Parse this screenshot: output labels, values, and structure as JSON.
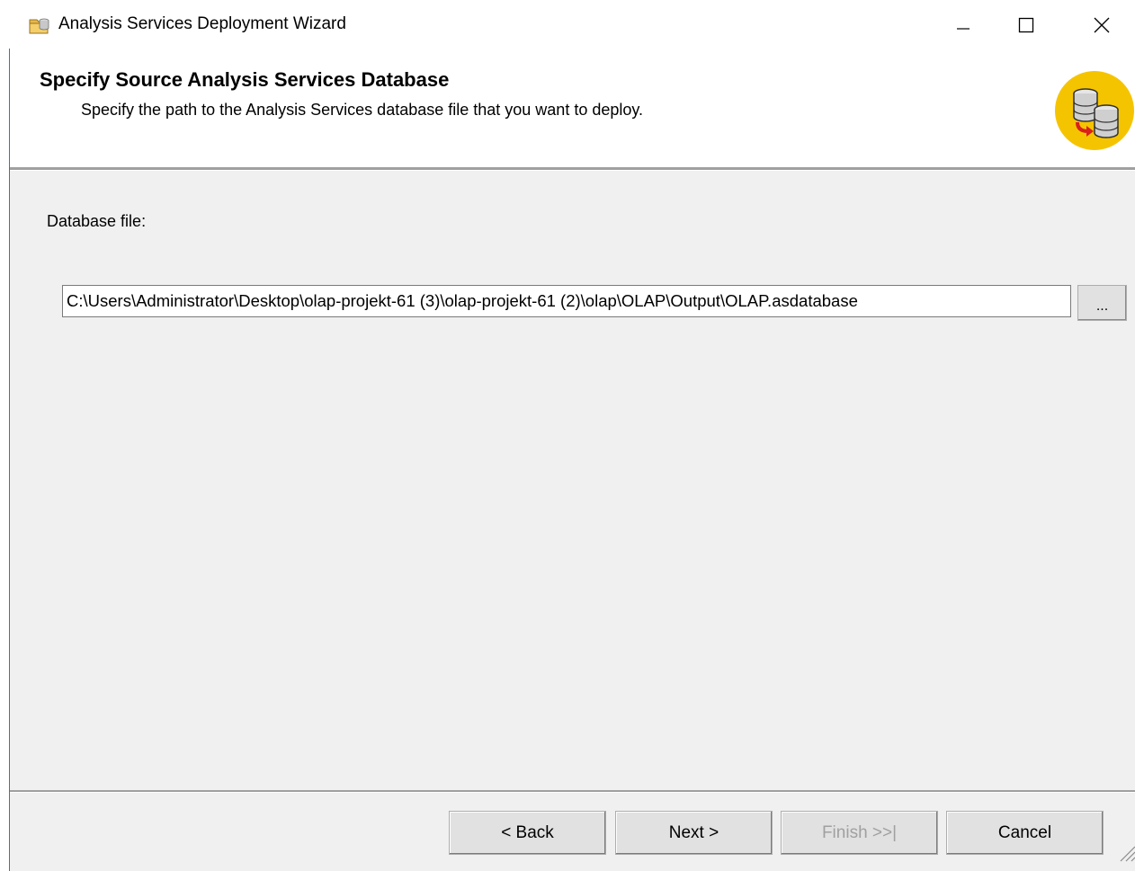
{
  "window": {
    "title": "Analysis Services Deployment Wizard",
    "icon": "database-folder-icon"
  },
  "caption_buttons": {
    "minimize_icon": "minimize-icon",
    "maximize_icon": "maximize-icon",
    "close_icon": "close-icon"
  },
  "header": {
    "title": "Specify Source Analysis Services Database",
    "subtitle": "Specify the path to the Analysis Services database file that you want to deploy.",
    "icon": "database-deploy-icon"
  },
  "body": {
    "database_file_label": "Database file:",
    "database_file_value": "C:\\Users\\Administrator\\Desktop\\olap-projekt-61 (3)\\olap-projekt-61 (2)\\olap\\OLAP\\Output\\OLAP.asdatabase",
    "browse_label": "..."
  },
  "footer": {
    "back_label": "< Back",
    "next_label": "Next >",
    "finish_label": "Finish >>|",
    "cancel_label": "Cancel",
    "finish_enabled": false
  },
  "colors": {
    "body_background": "#f0f0f0",
    "window_border": "#2b78c8",
    "header_icon_background": "#f5c400",
    "disabled_text": "#a0a0a0"
  }
}
